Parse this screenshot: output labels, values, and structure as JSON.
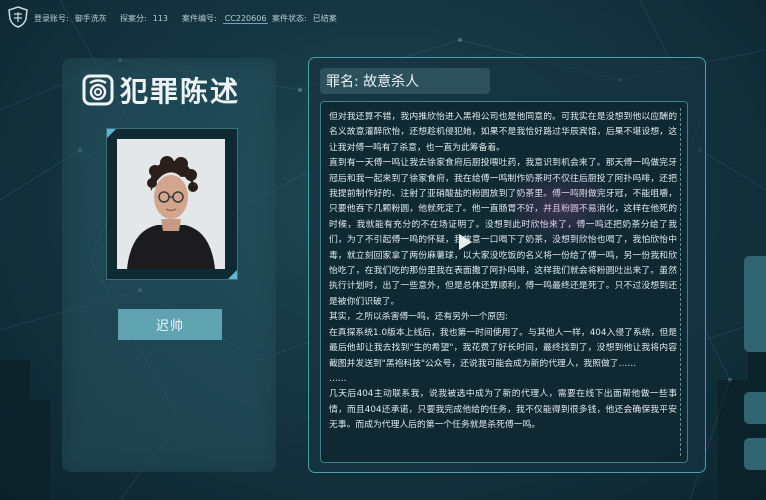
{
  "topbar": {
    "login_label": "登录账号:",
    "login_value": "御手洗灰",
    "score_label": "探案分:",
    "score_value": "113",
    "case_no_label": "案件编号:",
    "case_no_value": "CC220606",
    "case_status_label": "案件状态:",
    "case_status_value": "已结案"
  },
  "left_panel": {
    "title": "犯罪陈述",
    "suspect_name": "迟帅"
  },
  "right_panel": {
    "crime_label": "罪名: 故意杀人",
    "statement": [
      "但对我还算不错，我内推欣怡进入黑袍公司也是他同意的。可我实在是没想到他以应酬的名义故意灌醉欣怡，还想趁机侵犯她，如果不是我恰好路过华辰宾馆，后果不堪设想，这让我对傅一鸣有了杀意，也一直为此筹备着。",
      "直到有一天傅一鸣让我去徐家食府后厨投喂吐药，我意识到机会来了。那天傅一鸣做完牙冠后和我一起来到了徐家食府，我在给傅一鸣制作奶茶时不仅往后厨投了阿扑吗啡，还把我提前制作好的、注射了亚硝酸盐的粉圆放到了奶茶里。傅一鸣刚做完牙冠，不能咀嚼，只要他吞下几颗粉圆，他就死定了。他一直肠胃不好，并且粉圆不易消化，这样在他死的时候，我就能有充分的不在场证明了。没想到此时欣怡来了，傅一鸣还把奶茶分给了我们，为了不引起傅一鸣的怀疑，我故意一口喝下了奶茶，没想到欣怡也喝了，我怕欣怡中毒，就立刻回家拿了两份麻薯球，以大家没吃饭的名义将一份给了傅一鸣，另一份我和欣怡吃了，在我们吃的那份里我在表面撒了阿扑吗啡，这样我们就会将粉圆吐出来了。虽然执行计划时，出了一些意外，但是总体还算顺利，傅一鸣最终还是死了。只不过没想到还是被你们识破了。",
      "其实，之所以杀害傅一鸣，还有另外一个原因:",
      "在真探系统1.0版本上线后，我也第一时间使用了。与其他人一样，404入侵了系统，但是最后他却让我去找到\"生的希望\"，我花费了好长时间，最终找到了，没想到他让我将内容截图并发送到\"黑袍科技\"公众号，还说我可能会成为新的代理人，我照做了……",
      "……",
      "几天后404主动联系我，说我被选中成为了新的代理人，需要在线下出面帮他做一些事情，而且404还承诺，只要我完成他给的任务，我不仅能得到很多钱，他还会确保我平安无事。而成为代理人后的第一个任务就是杀死傅一鸣。"
    ]
  },
  "colors": {
    "panel_border": "#4f9cb0",
    "name_plate": "#5fa3b0",
    "accent_corner": "#5fb7d0"
  },
  "icons": [
    "shield-logo-icon",
    "fingerprint-icon",
    "play-icon",
    "suspect-photo"
  ]
}
